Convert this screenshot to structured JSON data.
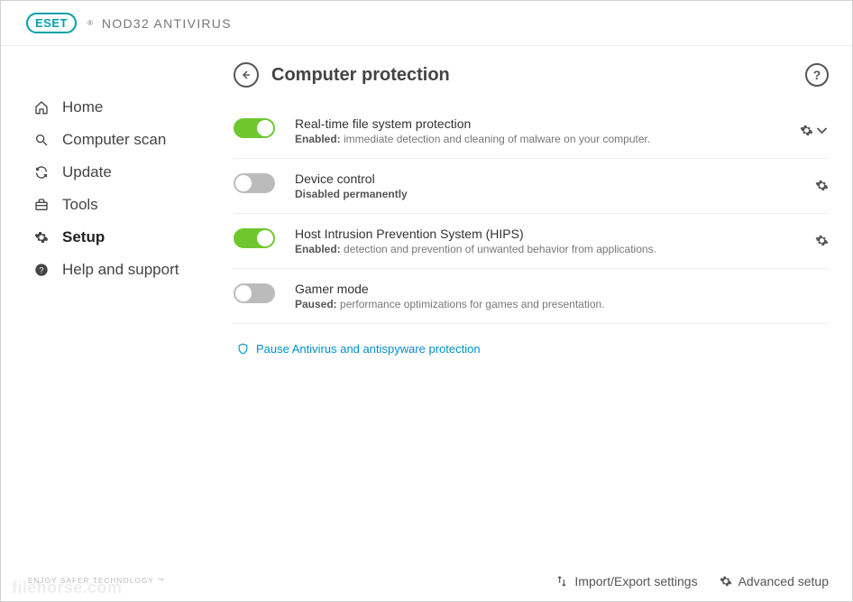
{
  "brand": {
    "eset": "ESET",
    "product": "NOD32 ANTIVIRUS"
  },
  "sidebar": {
    "items": [
      {
        "label": "Home"
      },
      {
        "label": "Computer scan"
      },
      {
        "label": "Update"
      },
      {
        "label": "Tools"
      },
      {
        "label": "Setup"
      },
      {
        "label": "Help and support"
      }
    ],
    "tagline": "ENJOY SAFER TECHNOLOGY ™"
  },
  "page": {
    "title": "Computer protection"
  },
  "settings": [
    {
      "title": "Real-time file system protection",
      "status": "Enabled:",
      "desc": "immediate detection and cleaning of malware on your computer."
    },
    {
      "title": "Device control",
      "status": "Disabled permanently",
      "desc": ""
    },
    {
      "title": "Host Intrusion Prevention System (HIPS)",
      "status": "Enabled:",
      "desc": "detection and prevention of unwanted behavior from applications."
    },
    {
      "title": "Gamer mode",
      "status": "Paused:",
      "desc": "performance optimizations for games and presentation."
    }
  ],
  "pause_link": "Pause Antivirus and antispyware protection",
  "footer": {
    "import_export": "Import/Export settings",
    "advanced": "Advanced setup"
  },
  "watermark": "filehorse.com"
}
